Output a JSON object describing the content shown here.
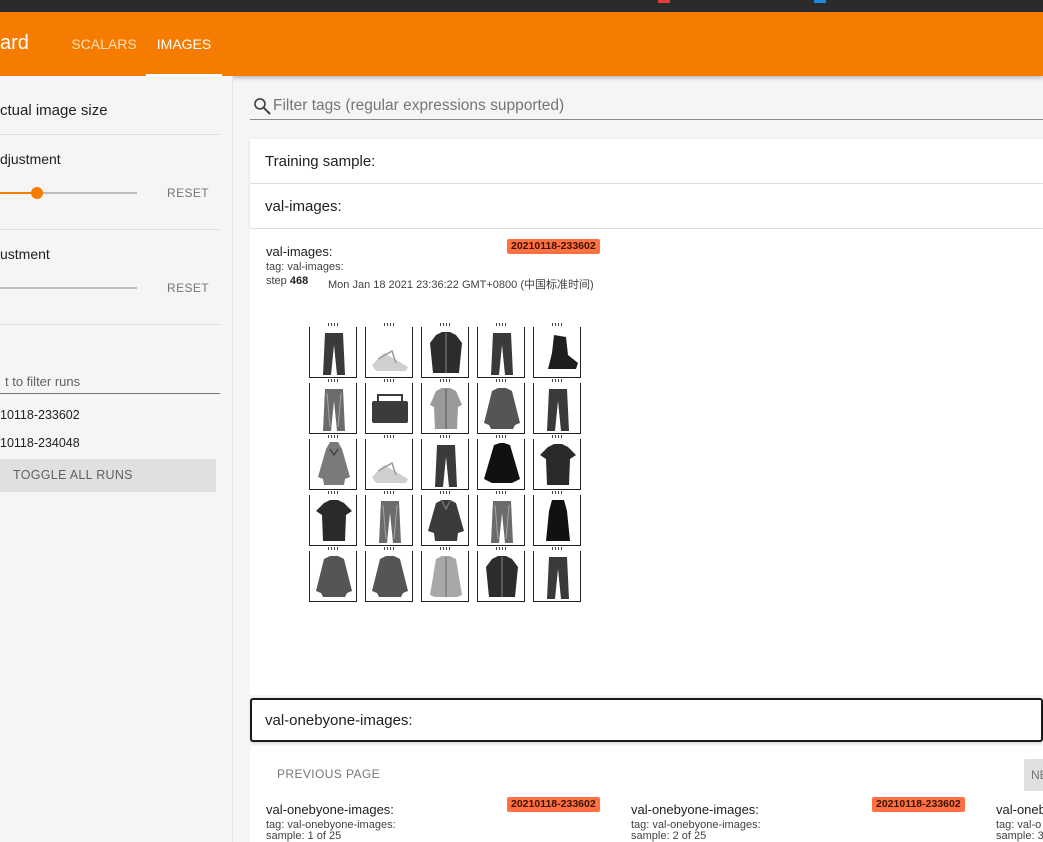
{
  "app": {
    "brand": "ard"
  },
  "tabs": [
    {
      "label": "SCALARS"
    },
    {
      "label": "IMAGES"
    }
  ],
  "sidebar": {
    "actual_size_label": "ctual image size",
    "brightness": {
      "label": "djustment",
      "reset": "RESET",
      "value_fraction": 0.27
    },
    "contrast": {
      "label": "ustment",
      "reset": "RESET",
      "value_fraction": 0.0
    },
    "run_filter": {
      "placeholder": "t to filter runs"
    },
    "runs": [
      {
        "name": "10118-233602"
      },
      {
        "name": "10118-234048"
      }
    ],
    "toggle_all": "TOGGLE ALL RUNS"
  },
  "search": {
    "placeholder": "Filter tags (regular expressions supported)"
  },
  "groups": [
    {
      "title": "Training sample:"
    },
    {
      "title": "val-images:"
    },
    {
      "title": "val-onebyone-images:"
    }
  ],
  "image_card": {
    "title": "val-images:",
    "run": "20210118-233602",
    "tag": "tag: val-images:",
    "step_label": "step",
    "step": "468",
    "timestamp": "Mon Jan 18 2021 23:36:22 GMT+0800 (中国标准时间)",
    "grid": [
      [
        "pants",
        "sandal",
        "jacket",
        "pants",
        "boot"
      ],
      [
        "jeans",
        "bag",
        "shirt",
        "sweater",
        "pants"
      ],
      [
        "hoodie",
        "sandal",
        "pants",
        "top",
        "tshirt"
      ],
      [
        "tshirt",
        "jeans",
        "blouse",
        "jeans",
        "dress"
      ],
      [
        "sweater",
        "sweater",
        "coat",
        "jacket",
        "pants"
      ]
    ]
  },
  "pager": {
    "previous": "PREVIOUS PAGE",
    "next": "NE"
  },
  "onebyone_cards": [
    {
      "title": "val-onebyone-images:",
      "run": "20210118-233602",
      "tag": "tag: val-onebyone-images:",
      "sample": "sample: 1 of 25"
    },
    {
      "title": "val-onebyone-images:",
      "run": "20210118-233602",
      "tag": "tag: val-onebyone-images:",
      "sample": "sample: 2 of 25"
    },
    {
      "title": "val-oneb",
      "tag": "tag: val-o",
      "sample": "sample: 3"
    }
  ],
  "colors": {
    "accent": "#f57c00",
    "run_badge": "#ff7043",
    "toolbar_text": "#ffffff"
  }
}
